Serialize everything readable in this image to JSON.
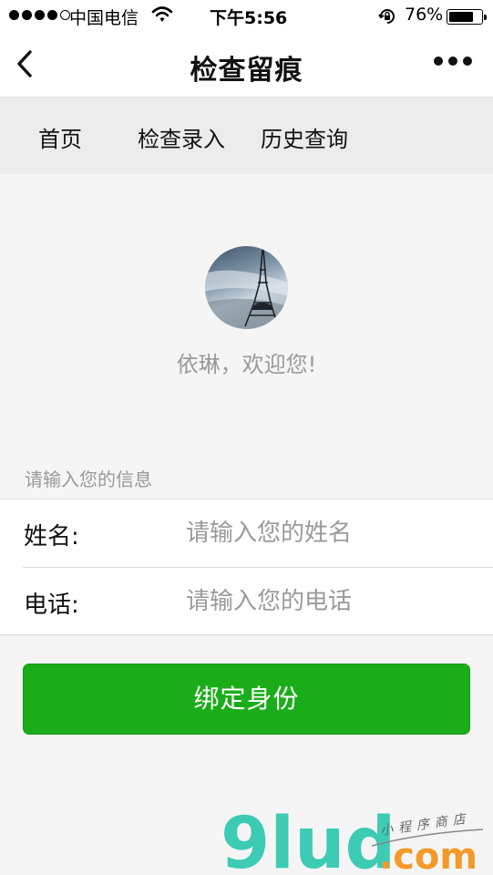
{
  "status_bar": {
    "carrier": "中国电信",
    "time": "下午5:56",
    "battery": "76%",
    "battery_level": 0.76
  },
  "nav": {
    "title": "检查留痕"
  },
  "tabs": [
    {
      "label": "首页"
    },
    {
      "label": "检查录入"
    },
    {
      "label": "历史查询"
    }
  ],
  "profile": {
    "greeting": "依琳，欢迎您!"
  },
  "form": {
    "section_label": "请输入您的信息",
    "name": {
      "label": "姓名:",
      "placeholder": "请输入您的姓名",
      "value": ""
    },
    "phone": {
      "label": "电话:",
      "placeholder": "请输入您的电话",
      "value": ""
    }
  },
  "button": {
    "label": "绑定身份"
  },
  "watermark": {
    "logo_text": "9lud",
    "domain": ".com",
    "tagline": "小程序商店"
  },
  "colors": {
    "primary_green": "#1aad19",
    "tab_bar_bg": "#ececec",
    "page_bg": "#f5f5f5",
    "hint_gray": "#9a9a9a"
  }
}
